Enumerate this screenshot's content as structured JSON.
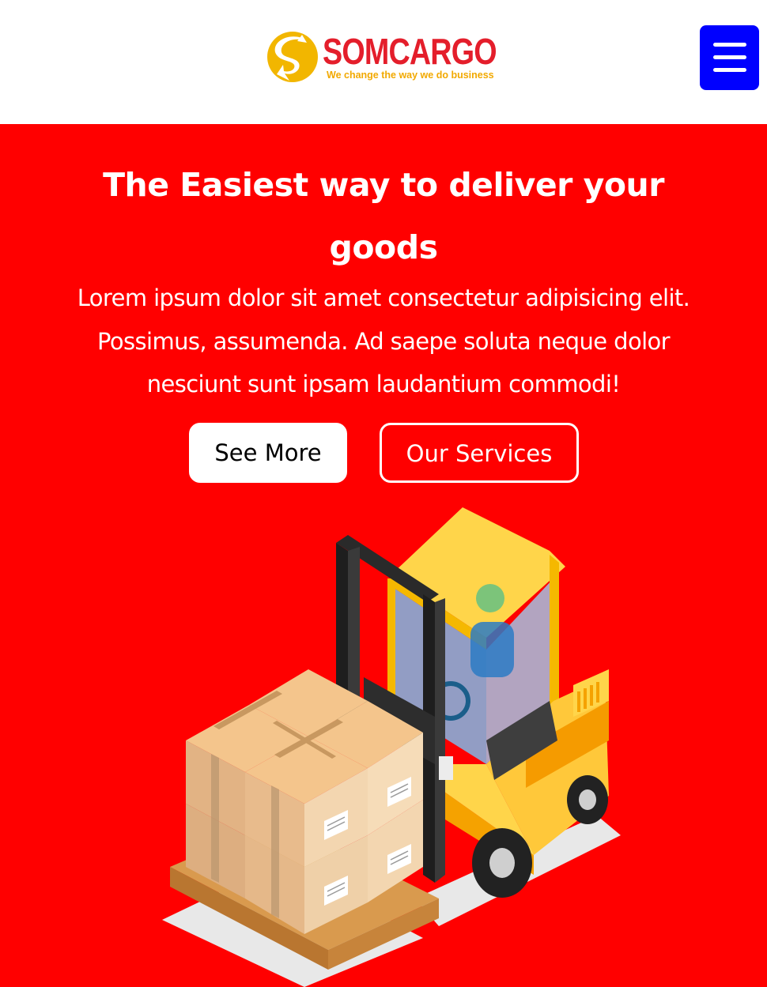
{
  "header": {
    "brand_name": "SOMCARGO",
    "tagline": "We change the way we do business",
    "menu_icon": "hamburger-menu-icon"
  },
  "hero": {
    "title": "The Easiest way to deliver your goods",
    "description": "Lorem ipsum dolor sit amet consectetur adipisicing elit. Possimus, assumenda. Ad saepe soluta neque dolor nesciunt sunt ipsam laudantium commodi!",
    "primary_button": "See More",
    "secondary_button": "Our Services",
    "illustration": "forklift-with-boxes-illustration"
  },
  "colors": {
    "brand_red": "#e41e2b",
    "brand_yellow": "#f2a900",
    "hero_background": "#ff0000",
    "menu_button": "#0000ff"
  }
}
